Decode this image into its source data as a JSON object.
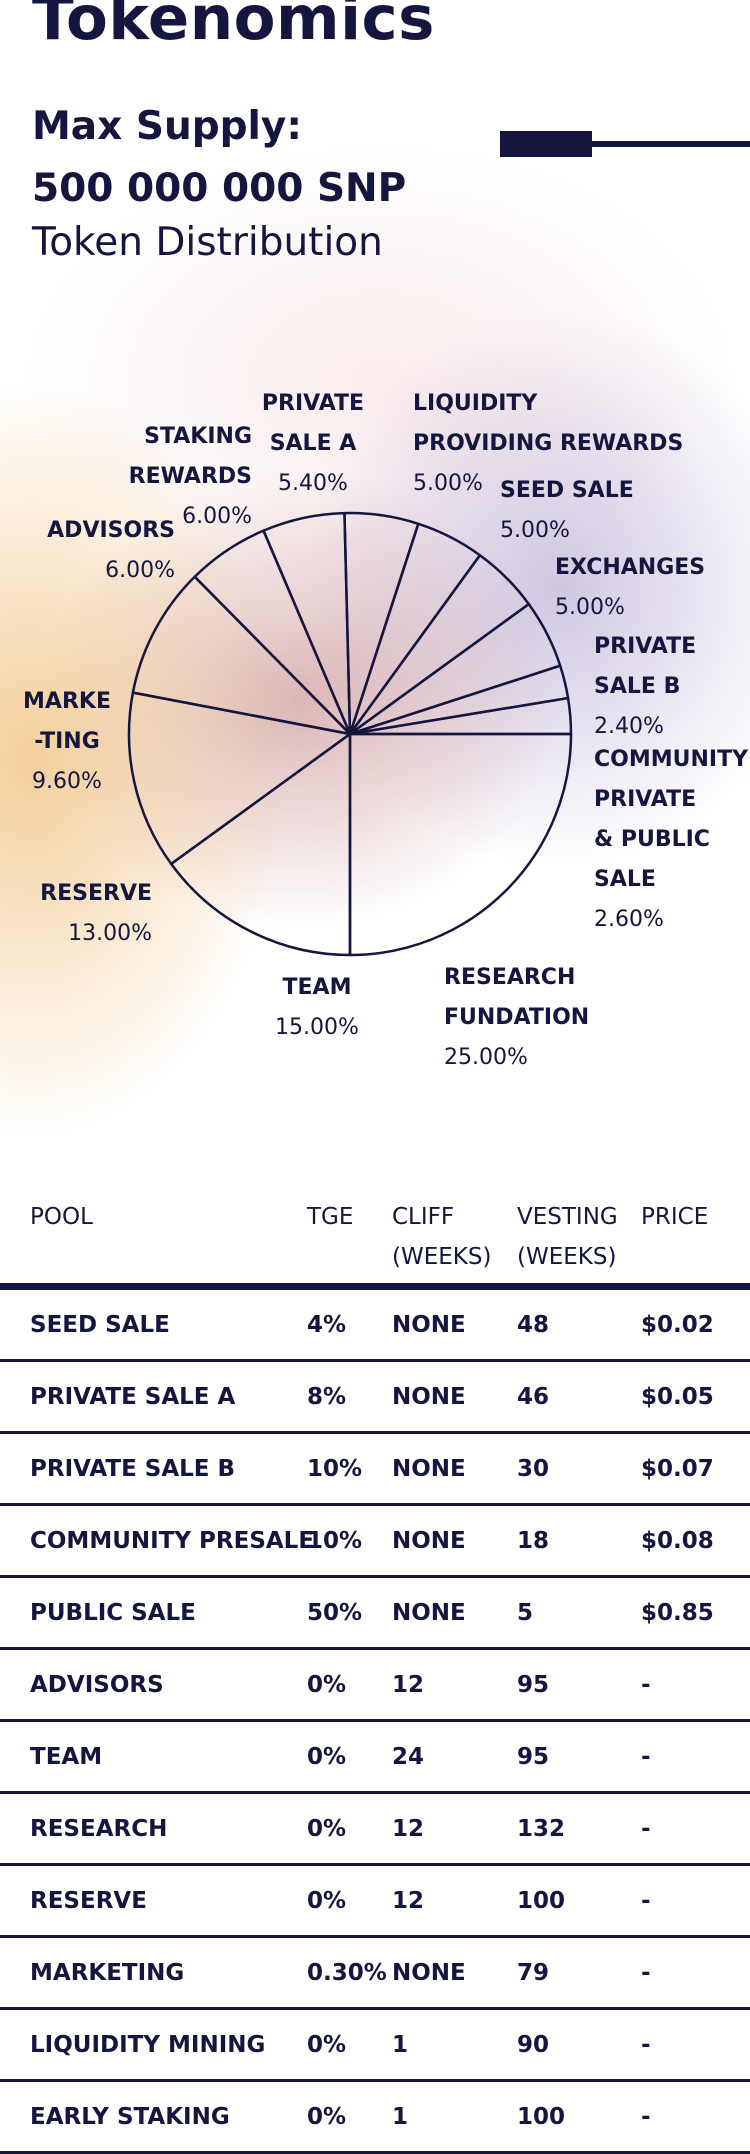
{
  "header": {
    "title": "Tokenomics",
    "max_supply_label": "Max Supply:",
    "max_supply_value": "500 000 000 SNP",
    "subtitle": "Token Distribution"
  },
  "chart_data": {
    "type": "pie",
    "title": "Token Distribution",
    "slices": [
      {
        "name": "RESEARCH FUNDATION",
        "label": "RESEARCH\nFUNDATION",
        "value": 25.0,
        "pct": "25.00%"
      },
      {
        "name": "TEAM",
        "label": "TEAM",
        "value": 15.0,
        "pct": "15.00%"
      },
      {
        "name": "RESERVE",
        "label": "RESERVE",
        "value": 13.0,
        "pct": "13.00%"
      },
      {
        "name": "MARKETING",
        "label": "MARKE\n-TING",
        "value": 9.6,
        "pct": "9.60%"
      },
      {
        "name": "ADVISORS",
        "label": "ADVISORS",
        "value": 6.0,
        "pct": "6.00%"
      },
      {
        "name": "STAKING REWARDS",
        "label": "STAKING\nREWARDS",
        "value": 6.0,
        "pct": "6.00%"
      },
      {
        "name": "PRIVATE SALE A",
        "label": "PRIVATE\nSALE A",
        "value": 5.4,
        "pct": "5.40%"
      },
      {
        "name": "LIQUIDITY PROVIDING REWARDS",
        "label": "LIQUIDITY\nPROVIDING REWARDS",
        "value": 5.0,
        "pct": "5.00%"
      },
      {
        "name": "SEED SALE",
        "label": "SEED SALE",
        "value": 5.0,
        "pct": "5.00%"
      },
      {
        "name": "EXCHANGES",
        "label": "EXCHANGES",
        "value": 5.0,
        "pct": "5.00%"
      },
      {
        "name": "PRIVATE SALE B",
        "label": "PRIVATE\nSALE B",
        "value": 2.4,
        "pct": "2.40%"
      },
      {
        "name": "COMMUNITY PRIVATE & PUBLIC SALE",
        "label": "COMMUNITY\nPRIVATE\n& PUBLIC\nSALE",
        "value": 2.6,
        "pct": "2.60%"
      }
    ]
  },
  "table": {
    "headers": [
      "POOL",
      "TGE",
      "CLIFF\n(WEEKS)",
      "VESTING\n(WEEKS)",
      "PRICE"
    ],
    "rows": [
      [
        "SEED SALE",
        "4%",
        "NONE",
        "48",
        "$0.02"
      ],
      [
        "PRIVATE SALE A",
        "8%",
        "NONE",
        "46",
        "$0.05"
      ],
      [
        "PRIVATE SALE B",
        "10%",
        "NONE",
        "30",
        "$0.07"
      ],
      [
        "COMMUNITY PRESALE",
        "10%",
        "NONE",
        "18",
        "$0.08"
      ],
      [
        "PUBLIC SALE",
        "50%",
        "NONE",
        "5",
        "$0.85"
      ],
      [
        "ADVISORS",
        "0%",
        "12",
        "95",
        "-"
      ],
      [
        "TEAM",
        "0%",
        "24",
        "95",
        "-"
      ],
      [
        "RESEARCH",
        "0%",
        "12",
        "132",
        "-"
      ],
      [
        "RESERVE",
        "0%",
        "12",
        "100",
        "-"
      ],
      [
        "MARKETING",
        "0.30%",
        "NONE",
        "79",
        "-"
      ],
      [
        "LIQUIDITY MINING",
        "0%",
        "1",
        "90",
        "-"
      ],
      [
        "EARLY STAKING",
        "0%",
        "1",
        "100",
        "-"
      ]
    ]
  },
  "colors": {
    "ink": "#14163f"
  }
}
